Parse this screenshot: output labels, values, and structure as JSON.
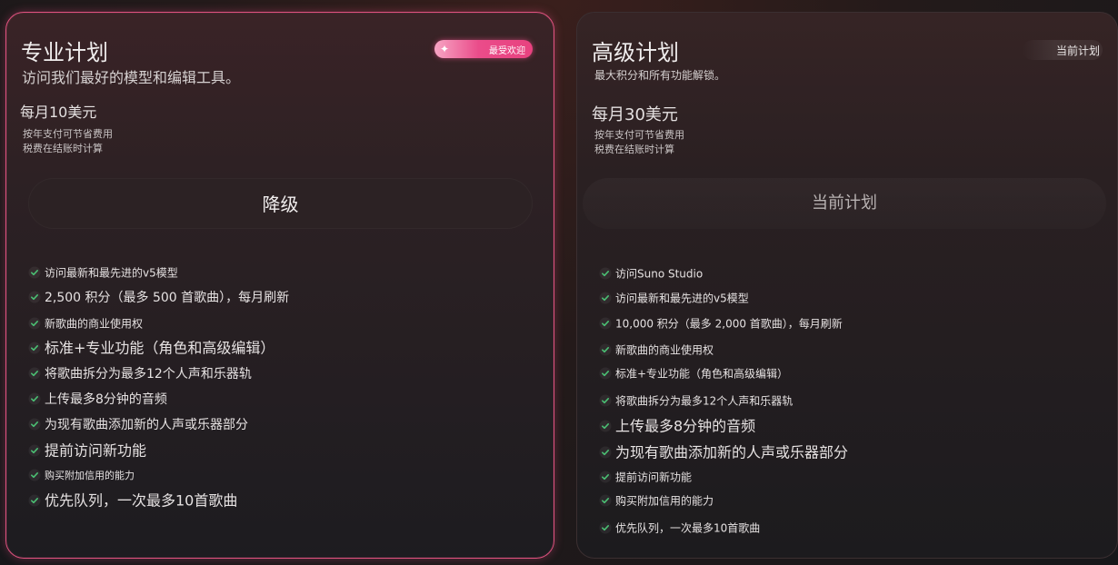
{
  "colors": {
    "accent_pink": "#e8427f",
    "check_green": "#4bbf73",
    "card_border_pro": "#e0527f"
  },
  "pro_plan": {
    "title": "专业计划",
    "badge": "最受欢迎",
    "description": "访问我们最好的模型和编辑工具。",
    "price": "每月10美元",
    "note_annual": "按年支付可节省费用",
    "note_tax": "税费在结账时计算",
    "cta_label": "降级",
    "check_icon": "check-icon",
    "features": [
      "访问最新和最先进的v5模型",
      "2,500 积分（最多 500 首歌曲），每月刷新",
      "新歌曲的商业使用权",
      "标准+专业功能（角色和高级编辑）",
      "将歌曲拆分为最多12个人声和乐器轨",
      "上传最多8分钟的音频",
      "为现有歌曲添加新的人声或乐器部分",
      "提前访问新功能",
      "购买附加信用的能力",
      "优先队列，一次最多10首歌曲"
    ]
  },
  "premier_plan": {
    "title": "高级计划",
    "badge": "当前计划",
    "description": "最大积分和所有功能解锁。",
    "price": "每月30美元",
    "note_annual": "按年支付可节省费用",
    "note_tax": "税费在结账时计算",
    "cta_label": "当前计划",
    "check_icon": "check-icon",
    "features": [
      "访问Suno Studio",
      "访问最新和最先进的v5模型",
      "10,000 积分（最多 2,000 首歌曲），每月刷新",
      "新歌曲的商业使用权",
      "标准+专业功能（角色和高级编辑）",
      "将歌曲拆分为最多12个人声和乐器轨",
      "上传最多8分钟的音频",
      "为现有歌曲添加新的人声或乐器部分",
      "提前访问新功能",
      "购买附加信用的能力",
      "优先队列，一次最多10首歌曲"
    ]
  }
}
